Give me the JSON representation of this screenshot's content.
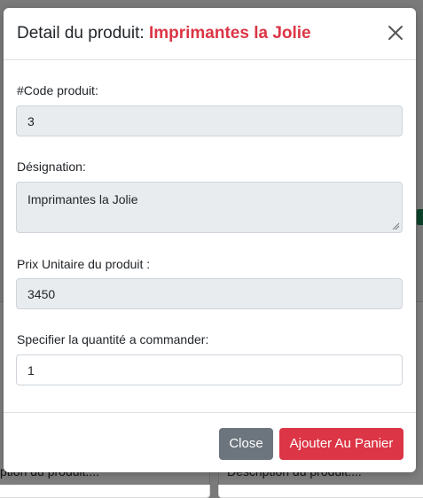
{
  "modal": {
    "title_prefix": "Detail du produit:",
    "title_product": "Imprimantes la Jolie",
    "fields": {
      "code": {
        "label": "#Code produit:",
        "value": "3"
      },
      "designation": {
        "label": "Désignation:",
        "value": "Imprimantes la Jolie"
      },
      "price": {
        "label": "Prix Unitaire du produit :",
        "value": "3450"
      },
      "quantity": {
        "label": "Specifier la quantité a commander:",
        "value": "1"
      }
    },
    "buttons": {
      "close": "Close",
      "add_to_cart": "Ajouter Au Panier"
    }
  },
  "background": {
    "card_left_desc": "ption du produit....",
    "card_right_desc": "Description du produit...."
  },
  "colors": {
    "accent": "#dc3545",
    "secondary": "#6c757d",
    "readonly_bg": "#e9ecef"
  },
  "icons": {
    "close": "close-icon"
  }
}
